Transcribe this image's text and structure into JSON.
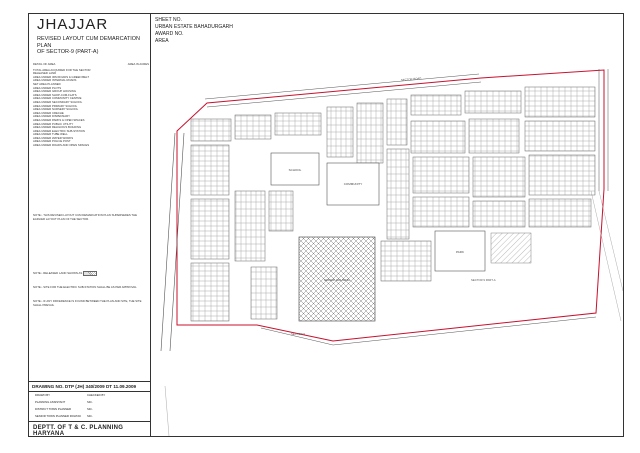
{
  "title_block": {
    "town": "JHAJJAR",
    "subtitle_line1": "REVISED LAYOUT CUM DEMARCATION PLAN",
    "subtitle_line2": "OF SECTOR-9 (PART-A)"
  },
  "header": {
    "sheet_no": "SHEET NO.",
    "estate": "URBAN ESTATE BAHADURGARH",
    "award_no": "AWARD NO.",
    "area": "AREA"
  },
  "stats_header": {
    "detail": "DETAIL OF AREA",
    "area_col": "AREA IN ACRES"
  },
  "stats": [
    {
      "label": "TOTAL AREA ACQUIRED FOR THE SECTOR",
      "value": ""
    },
    {
      "label": "RELEASED LAND",
      "value": ""
    },
    {
      "label": "AREA UNDER 30M ROADS & GREEN BELT",
      "value": ""
    },
    {
      "label": "AREA UNDER INTERNAL ROADS",
      "value": ""
    },
    {
      "label": "NET AREA PLANNED",
      "value": ""
    },
    {
      "label": "AREA UNDER PLOTS",
      "value": ""
    },
    {
      "label": "AREA UNDER GROUP HOUSING",
      "value": ""
    },
    {
      "label": "AREA UNDER SHOP-CUM-FLATS",
      "value": ""
    },
    {
      "label": "AREA UNDER COMMUNITY CENTRE",
      "value": ""
    },
    {
      "label": "AREA UNDER SECONDARY SCHOOL",
      "value": ""
    },
    {
      "label": "AREA UNDER PRIMARY SCHOOL",
      "value": ""
    },
    {
      "label": "AREA UNDER NURSERY SCHOOL",
      "value": ""
    },
    {
      "label": "AREA UNDER CRECHE",
      "value": ""
    },
    {
      "label": "AREA UNDER DISPENSARY",
      "value": ""
    },
    {
      "label": "AREA UNDER PARKS & OPEN SPACES",
      "value": ""
    },
    {
      "label": "AREA UNDER PUBLIC UTILITY",
      "value": ""
    },
    {
      "label": "AREA UNDER RELIGIOUS BUILDING",
      "value": ""
    },
    {
      "label": "AREA UNDER ELECTRIC SUB-STATION",
      "value": ""
    },
    {
      "label": "AREA UNDER TUBE WELL",
      "value": ""
    },
    {
      "label": "AREA UNDER WATER WORKS",
      "value": ""
    },
    {
      "label": "AREA UNDER POLICE POST",
      "value": ""
    },
    {
      "label": "AREA UNDER ROADS AND OPEN SPACES",
      "value": ""
    }
  ],
  "note1": "NOTE:- THIS REVISED LAYOUT CUM DEMARCATION PLAN SUPERSEDES THE EARLIER LAYOUT PLAN OF THE SECTOR.",
  "note2": "NOTE:- RELEASED LAND SHOWN AS",
  "note3": "NOTE:- SITE FOR THE ELECTRIC SUB-STATION SHALL BE AS PER APPROVAL",
  "note4": "NOTE:- IF ANY DIFFERENCE IS FOUND BETWEEN THE PLAN AND SITE, THE SITE SHALL PREVAIL",
  "drawing_no": "DRAWING NO. DTP (JH) 340/2009 DT 11.09.2009",
  "sign_rows": [
    {
      "left": "DRAWN BY",
      "right": "CHECKED BY"
    },
    {
      "left": "PLANNING ASSISTANT",
      "right": "SD/-"
    },
    {
      "left": "DISTRICT TOWN PLANNER",
      "right": "SD/-"
    },
    {
      "left": "SENIOR TOWN PLANNER ROHTAK",
      "right": "SD/-"
    }
  ],
  "department": "DEPTT. OF T & C. PLANNING HARYANA",
  "plan_labels": {
    "sector_road": "SECTOR ROAD",
    "school": "SCHOOL",
    "park": "PARK",
    "community": "COMMUNITY",
    "group_housing": "GROUP HOUSING",
    "sector_a": "SECTOR 9 PART-A",
    "sector_9": "SECTOR 9"
  },
  "colors": {
    "boundary": "#c8102e",
    "ink": "#444444"
  }
}
